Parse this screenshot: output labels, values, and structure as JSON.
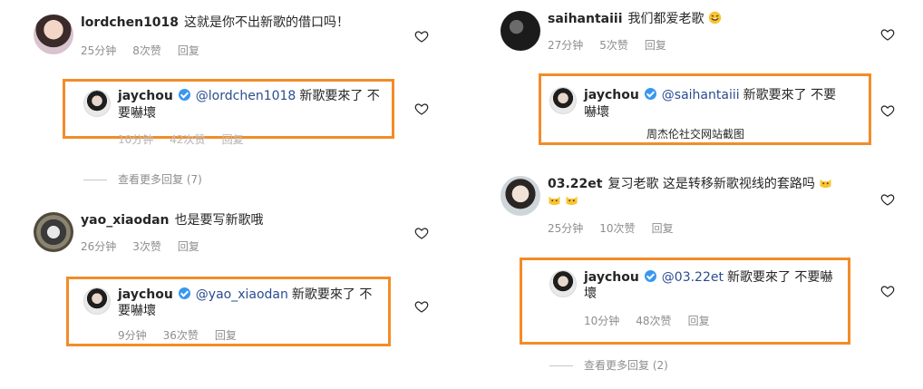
{
  "left": {
    "c1": {
      "username": "lordchen1018",
      "text": "这就是你不出新歌的借口吗！",
      "time": "25分钟",
      "likes": "8次赞",
      "reply": "回复"
    },
    "r1": {
      "username": "jaychou",
      "mention": "@lordchen1018",
      "text1": "新歌要來了 不",
      "text2": "要嚇壞",
      "time": "10分钟",
      "likes": "42次赞",
      "reply": "回复"
    },
    "more1": "查看更多回复 (7)",
    "c2": {
      "username": "yao_xiaodan",
      "text": "也是要写新歌哦",
      "time": "26分钟",
      "likes": "3次赞",
      "reply": "回复"
    },
    "r2": {
      "username": "jaychou",
      "mention": "@yao_xiaodan",
      "text1": "新歌要來了 不",
      "text2": "要嚇壞",
      "time": "9分钟",
      "likes": "36次赞",
      "reply": "回复"
    }
  },
  "right": {
    "c1": {
      "username": "saihantaiii",
      "text": "我们都爱老歌",
      "time": "27分钟",
      "likes": "5次赞",
      "reply": "回复"
    },
    "r1": {
      "username": "jaychou",
      "mention": "@saihantaiii",
      "text1": "新歌要來了 不要",
      "text2": "嚇壞",
      "caption": "周杰伦社交网站截图"
    },
    "c2": {
      "username": "03.22et",
      "text": "复习老歌 这是转移新歌视线的套路吗",
      "time": "25分钟",
      "likes": "10次赞",
      "reply": "回复"
    },
    "r2": {
      "username": "jaychou",
      "mention": "@03.22et",
      "text1": "新歌要來了 不要嚇",
      "text2": "壞",
      "time": "10分钟",
      "likes": "48次赞",
      "reply": "回复"
    },
    "more2": "查看更多回复 (2)"
  },
  "icons": {
    "heart": "heart-outline-icon",
    "verified": "verified-badge-icon",
    "emoji_laugh": "rofl-emoji-icon",
    "emoji_cat": "cat-emoji-icon"
  },
  "colors": {
    "highlight": "#f28c28",
    "meta": "#8e8e8e",
    "verified": "#3897f0"
  }
}
